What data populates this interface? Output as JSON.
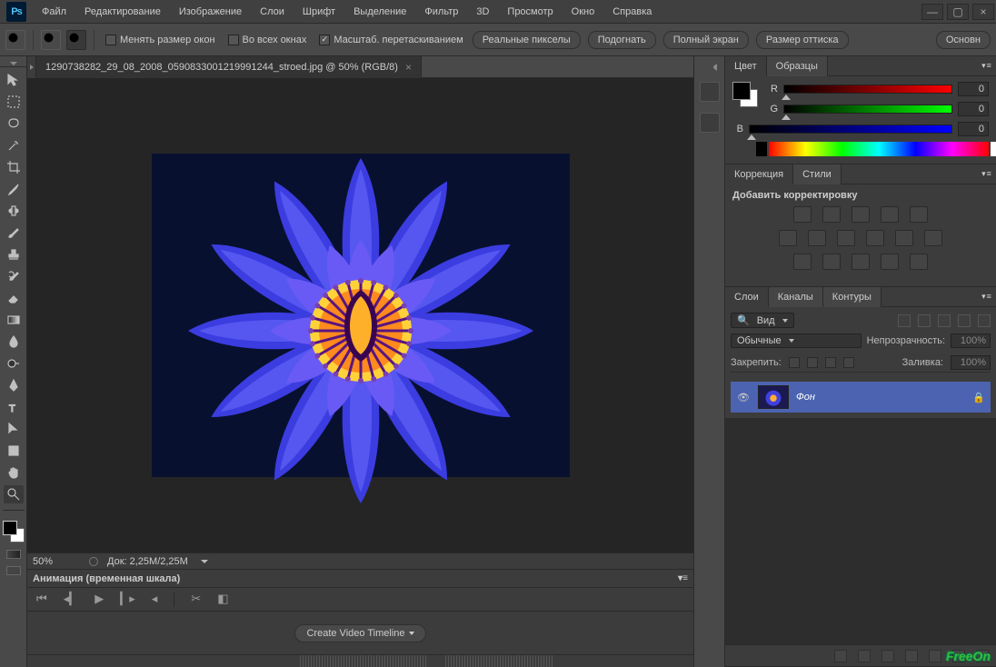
{
  "menubar": {
    "items": [
      "Файл",
      "Редактирование",
      "Изображение",
      "Слои",
      "Шрифт",
      "Выделение",
      "Фильтр",
      "3D",
      "Просмотр",
      "Окно",
      "Справка"
    ]
  },
  "optbar": {
    "resize_windows": "Менять размер окон",
    "all_windows": "Во всех окнах",
    "scrubby_zoom": "Масштаб. перетаскиванием",
    "actual_pixels": "Реальные пикселы",
    "fit": "Подогнать",
    "fullscreen": "Полный экран",
    "print_size": "Размер оттиска",
    "right_label": "Основн"
  },
  "document": {
    "tab": "1290738282_29_08_2008_0590833001219991244_stroed.jpg @ 50% (RGB/8)",
    "zoom_display": "50%",
    "doc_size": "Док: 2,25M/2,25M"
  },
  "timeline": {
    "title": "Анимация (временная шкала)",
    "create_btn": "Create Video Timeline"
  },
  "panels": {
    "color": {
      "tab": "Цвет",
      "tab2": "Образцы",
      "r": "R",
      "g": "G",
      "b": "B",
      "rv": "0",
      "gv": "0",
      "bv": "0"
    },
    "adjust": {
      "tab": "Коррекция",
      "tab2": "Стили",
      "title": "Добавить корректировку"
    },
    "layers": {
      "tab": "Слои",
      "tab2": "Каналы",
      "tab3": "Контуры",
      "kind": "Вид",
      "blend": "Обычные",
      "opacity_lbl": "Непрозрачность:",
      "opacity_val": "100%",
      "lock_lbl": "Закрепить:",
      "fill_lbl": "Заливка:",
      "fill_val": "100%",
      "layer_name": "Фон"
    }
  },
  "watermark": "FreeOn"
}
